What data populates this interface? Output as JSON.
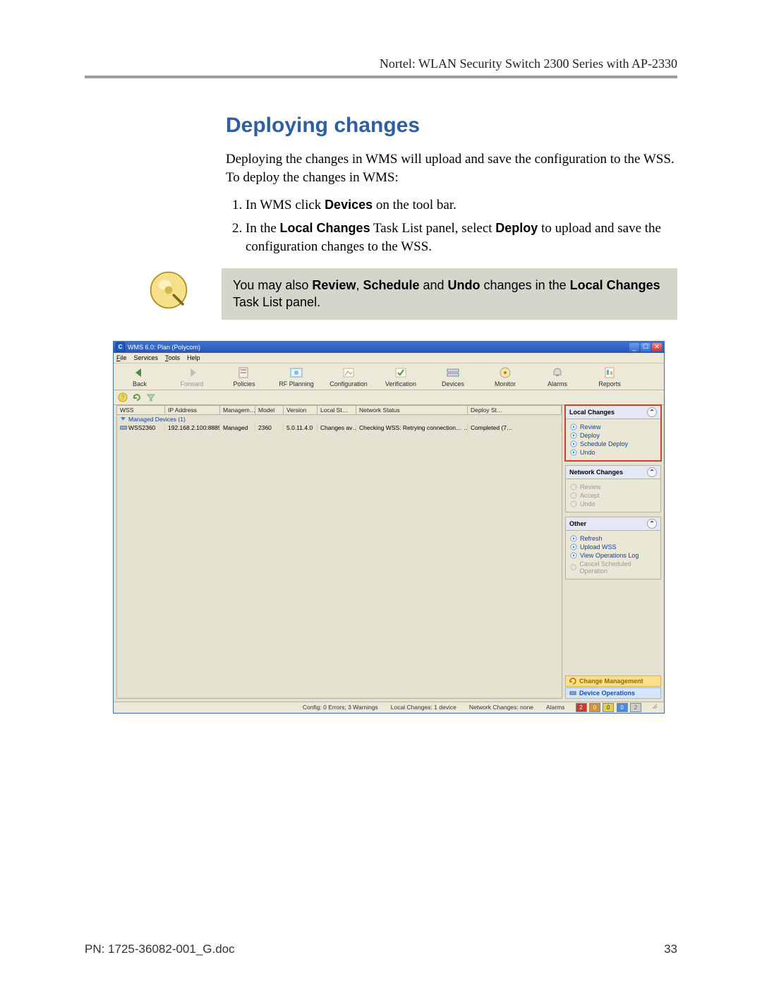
{
  "doc": {
    "header": "Nortel: WLAN Security Switch 2300 Series with AP-2330",
    "section_title": "Deploying changes",
    "intro": "Deploying the changes in WMS will upload and save the configuration to the WSS. To deploy the changes in WMS:",
    "steps": {
      "s1_a": "In WMS click ",
      "s1_b_bold": "Devices",
      "s1_c": " on the tool bar.",
      "s2_a": "In the ",
      "s2_b_bold": "Local Changes",
      "s2_c": " Task List panel, select ",
      "s2_d_bold": "Deploy",
      "s2_e": " to upload and save the configuration changes to the WSS."
    },
    "note_a": "You may also ",
    "note_b_bold": "Review",
    "note_c": ", ",
    "note_d_bold": "Schedule",
    "note_e": " and ",
    "note_f_bold": "Undo",
    "note_g": " changes in the ",
    "note_h_bold": "Local Changes",
    "note_i": " Task List panel.",
    "footer_left": "PN: 1725-36082-001_G.doc",
    "footer_right": "33"
  },
  "app": {
    "title": "WMS 6.0: Plan (Polycom)",
    "menus": {
      "file": "File",
      "services": "Services",
      "tools": "Tools",
      "help": "Help"
    },
    "toolbar": {
      "back": "Back",
      "forward": "Forward",
      "policies": "Policies",
      "rf": "RF Planning",
      "config": "Configuration",
      "verify": "Verification",
      "devices": "Devices",
      "monitor": "Monitor",
      "alarms": "Alarms",
      "reports": "Reports"
    },
    "grid": {
      "headers": {
        "wss": "WSS",
        "ip": "IP Address",
        "mgmt": "Managem…",
        "model": "Model",
        "version": "Version",
        "local": "Local St…",
        "net": "Network Status",
        "deploy": "Deploy St…"
      },
      "group": "Managed Devices (1)",
      "row": {
        "wss": "WSS2360",
        "ip": "192.168.2.100:8889",
        "mgmt": "Managed",
        "model": "2360",
        "version": "5.0.11.4.0",
        "local": "Changes av…",
        "net": "Checking WSS: Retrying connection…  …",
        "deploy": "Completed (7…"
      }
    },
    "panels": {
      "local": {
        "title": "Local Changes",
        "review": "Review",
        "deploy": "Deploy",
        "schedule": "Schedule Deploy",
        "undo": "Undo"
      },
      "network": {
        "title": "Network Changes",
        "review": "Review",
        "accept": "Accept",
        "undo": "Undo"
      },
      "other": {
        "title": "Other",
        "refresh": "Refresh",
        "upload": "Upload WSS",
        "viewlog": "View Operations Log",
        "cancel": "Cancel Scheduled Operation"
      },
      "change_mgmt": "Change Management",
      "device_ops": "Device Operations"
    },
    "status": {
      "config": "Config: 0 Errors; 3 Warnings",
      "local": "Local Changes: 1 device",
      "network": "Network Changes: none",
      "alarms_label": "Alarms",
      "leds": {
        "red": "2",
        "orange": "0",
        "yellow": "0",
        "blue": "0",
        "grey": "2"
      }
    }
  }
}
